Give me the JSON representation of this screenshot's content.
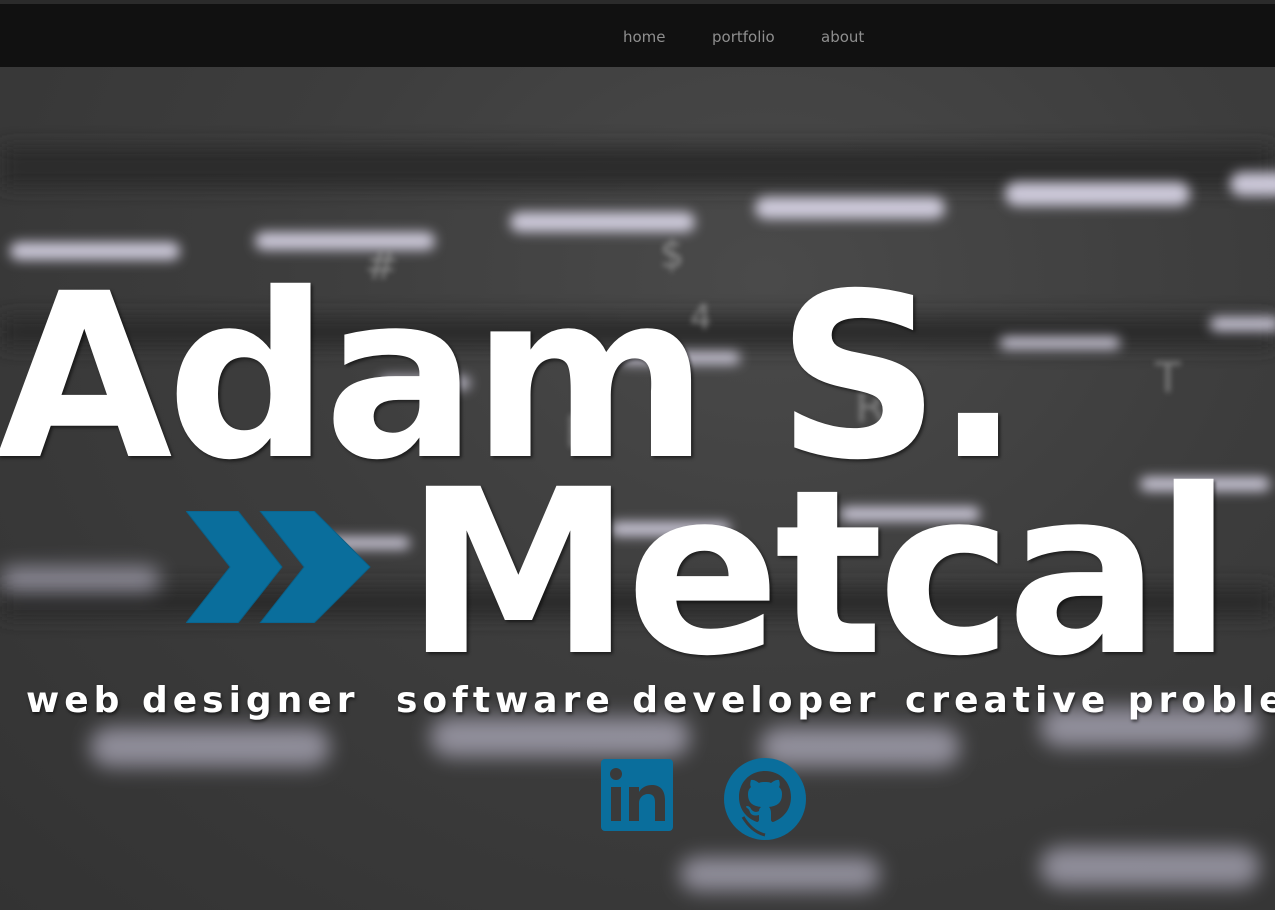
{
  "nav": {
    "items": [
      {
        "label": "home"
      },
      {
        "label": "portfolio"
      },
      {
        "label": "about"
      }
    ]
  },
  "hero": {
    "name_line1": "Adam S.",
    "name_line2": "Metcal",
    "taglines": [
      "web designer",
      "software developer",
      "creative probler"
    ]
  },
  "social": {
    "linkedin_icon": "linkedin-icon",
    "github_icon": "github-icon"
  },
  "colors": {
    "navbar": "#111111",
    "nav_text": "#8f8f8f",
    "accent_blue": "#0a6e9c",
    "hero_text": "#ffffff"
  }
}
